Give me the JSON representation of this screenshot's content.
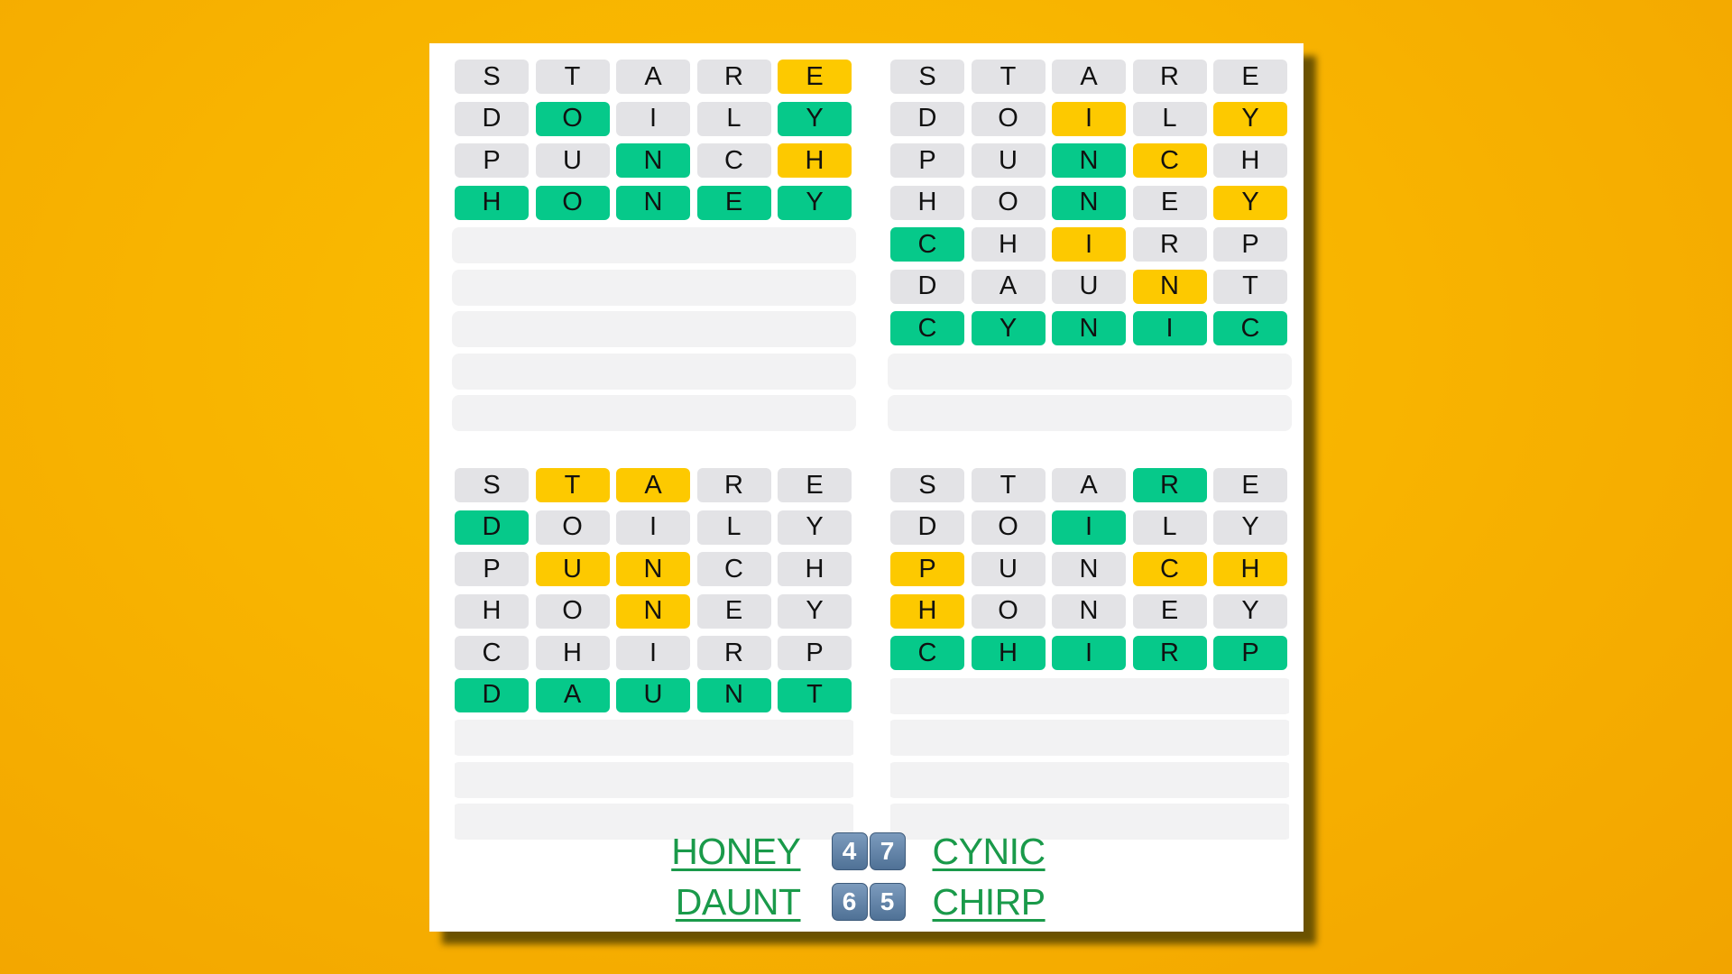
{
  "colors": {
    "green": "#06c98a",
    "yellow": "#fdc900",
    "gray": "#e3e3e6",
    "link": "#1a9a4a",
    "background": "#f8b400"
  },
  "boards": [
    {
      "answer": "HONEY",
      "guess_count": 4,
      "rows": [
        {
          "letters": [
            "S",
            "T",
            "A",
            "R",
            "E"
          ],
          "states": [
            "gray",
            "gray",
            "gray",
            "gray",
            "yellow"
          ]
        },
        {
          "letters": [
            "D",
            "O",
            "I",
            "L",
            "Y"
          ],
          "states": [
            "gray",
            "green",
            "gray",
            "gray",
            "green"
          ]
        },
        {
          "letters": [
            "P",
            "U",
            "N",
            "C",
            "H"
          ],
          "states": [
            "gray",
            "gray",
            "green",
            "gray",
            "yellow"
          ]
        },
        {
          "letters": [
            "H",
            "O",
            "N",
            "E",
            "Y"
          ],
          "states": [
            "green",
            "green",
            "green",
            "green",
            "green"
          ]
        }
      ],
      "empty_rows": 5
    },
    {
      "answer": "CYNIC",
      "guess_count": 7,
      "rows": [
        {
          "letters": [
            "S",
            "T",
            "A",
            "R",
            "E"
          ],
          "states": [
            "gray",
            "gray",
            "gray",
            "gray",
            "gray"
          ]
        },
        {
          "letters": [
            "D",
            "O",
            "I",
            "L",
            "Y"
          ],
          "states": [
            "gray",
            "gray",
            "yellow",
            "gray",
            "yellow"
          ]
        },
        {
          "letters": [
            "P",
            "U",
            "N",
            "C",
            "H"
          ],
          "states": [
            "gray",
            "gray",
            "green",
            "yellow",
            "gray"
          ]
        },
        {
          "letters": [
            "H",
            "O",
            "N",
            "E",
            "Y"
          ],
          "states": [
            "gray",
            "gray",
            "green",
            "gray",
            "yellow"
          ]
        },
        {
          "letters": [
            "C",
            "H",
            "I",
            "R",
            "P"
          ],
          "states": [
            "green",
            "gray",
            "yellow",
            "gray",
            "gray"
          ]
        },
        {
          "letters": [
            "D",
            "A",
            "U",
            "N",
            "T"
          ],
          "states": [
            "gray",
            "gray",
            "gray",
            "yellow",
            "gray"
          ]
        },
        {
          "letters": [
            "C",
            "Y",
            "N",
            "I",
            "C"
          ],
          "states": [
            "green",
            "green",
            "green",
            "green",
            "green"
          ]
        }
      ],
      "empty_rows": 2
    },
    {
      "answer": "DAUNT",
      "guess_count": 6,
      "rows": [
        {
          "letters": [
            "S",
            "T",
            "A",
            "R",
            "E"
          ],
          "states": [
            "gray",
            "yellow",
            "yellow",
            "gray",
            "gray"
          ]
        },
        {
          "letters": [
            "D",
            "O",
            "I",
            "L",
            "Y"
          ],
          "states": [
            "green",
            "gray",
            "gray",
            "gray",
            "gray"
          ]
        },
        {
          "letters": [
            "P",
            "U",
            "N",
            "C",
            "H"
          ],
          "states": [
            "gray",
            "yellow",
            "yellow",
            "gray",
            "gray"
          ]
        },
        {
          "letters": [
            "H",
            "O",
            "N",
            "E",
            "Y"
          ],
          "states": [
            "gray",
            "gray",
            "yellow",
            "gray",
            "gray"
          ]
        },
        {
          "letters": [
            "C",
            "H",
            "I",
            "R",
            "P"
          ],
          "states": [
            "gray",
            "gray",
            "gray",
            "gray",
            "gray"
          ]
        },
        {
          "letters": [
            "D",
            "A",
            "U",
            "N",
            "T"
          ],
          "states": [
            "green",
            "green",
            "green",
            "green",
            "green"
          ]
        }
      ],
      "empty_rows": 3
    },
    {
      "answer": "CHIRP",
      "guess_count": 5,
      "rows": [
        {
          "letters": [
            "S",
            "T",
            "A",
            "R",
            "E"
          ],
          "states": [
            "gray",
            "gray",
            "gray",
            "green",
            "gray"
          ]
        },
        {
          "letters": [
            "D",
            "O",
            "I",
            "L",
            "Y"
          ],
          "states": [
            "gray",
            "gray",
            "green",
            "gray",
            "gray"
          ]
        },
        {
          "letters": [
            "P",
            "U",
            "N",
            "C",
            "H"
          ],
          "states": [
            "yellow",
            "gray",
            "gray",
            "yellow",
            "yellow"
          ]
        },
        {
          "letters": [
            "H",
            "O",
            "N",
            "E",
            "Y"
          ],
          "states": [
            "yellow",
            "gray",
            "gray",
            "gray",
            "gray"
          ]
        },
        {
          "letters": [
            "C",
            "H",
            "I",
            "R",
            "P"
          ],
          "states": [
            "green",
            "green",
            "green",
            "green",
            "green"
          ]
        }
      ],
      "empty_rows": 4
    }
  ],
  "summary": {
    "rows": [
      {
        "left_word": "HONEY",
        "scores": [
          "4",
          "7"
        ],
        "right_word": "CYNIC"
      },
      {
        "left_word": "DAUNT",
        "scores": [
          "6",
          "5"
        ],
        "right_word": "CHIRP"
      }
    ]
  }
}
